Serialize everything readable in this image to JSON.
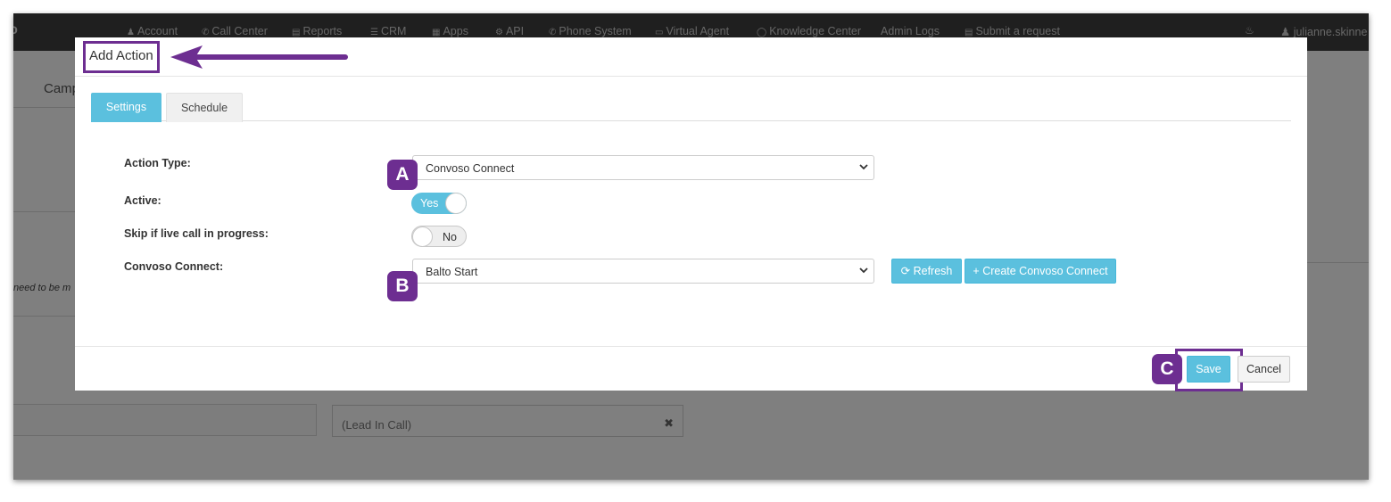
{
  "topnav": {
    "items": [
      {
        "icon": "user-icon",
        "label": "Account"
      },
      {
        "icon": "phone-icon",
        "label": "Call Center"
      },
      {
        "icon": "bar-chart-icon",
        "label": "Reports"
      },
      {
        "icon": "list-icon",
        "label": "CRM"
      },
      {
        "icon": "grid-icon",
        "label": "Apps"
      },
      {
        "icon": "gear-icon",
        "label": "API"
      },
      {
        "icon": "phone-icon",
        "label": "Phone System"
      },
      {
        "icon": "monitor-icon",
        "label": "Virtual Agent"
      },
      {
        "icon": "lightbulb-icon",
        "label": "Knowledge Center"
      },
      {
        "icon": "",
        "label": "Admin Logs"
      },
      {
        "icon": "ticket-icon",
        "label": "Submit a request"
      }
    ],
    "user": "julianne.skinne"
  },
  "background": {
    "tab_label": "Camp",
    "italic_text": "need to be m",
    "lead_field": "(Lead In Call)"
  },
  "modal": {
    "title": "Add Action",
    "tabs": [
      "Settings",
      "Schedule"
    ],
    "fields": {
      "action_type_label": "Action Type:",
      "action_type_value": "Convoso Connect",
      "active_label": "Active:",
      "active_value": "Yes",
      "skip_label": "Skip if live call in progress:",
      "skip_value": "No",
      "convoso_connect_label": "Convoso Connect:",
      "convoso_connect_value": "Balto Start"
    },
    "buttons": {
      "refresh": "Refresh",
      "create": "+ Create Convoso Connect",
      "save": "Save",
      "cancel": "Cancel"
    }
  },
  "annotations": {
    "a": "A",
    "b": "B",
    "c": "C",
    "color": "#6d2e91"
  }
}
